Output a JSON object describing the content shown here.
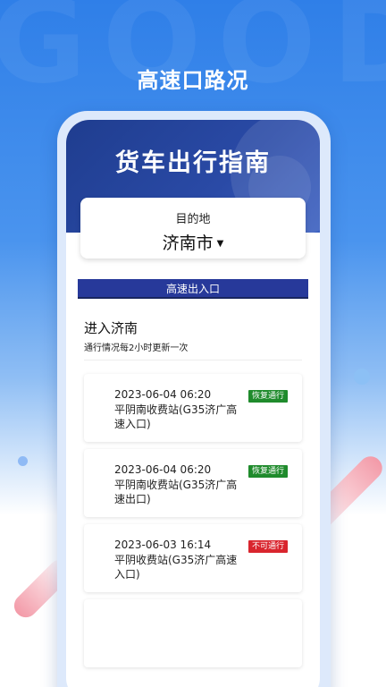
{
  "watermark": "GOOD",
  "header": {
    "title": "高速口路况"
  },
  "banner": {
    "title": "货车出行指南"
  },
  "city": {
    "label": "目的地",
    "value": "济南市",
    "caret": "▼"
  },
  "tab": {
    "label": "高速出入口"
  },
  "section": {
    "title": "进入济南",
    "subtitle": "通行情况每2小时更新一次"
  },
  "items": [
    {
      "time": "2023-06-04 06:20",
      "location": "平阴南收费站(G35济广高速入口)",
      "status": "恢复通行",
      "status_color": "#1f8b2c"
    },
    {
      "time": "2023-06-04 06:20",
      "location": "平阴南收费站(G35济广高速出口)",
      "status": "恢复通行",
      "status_color": "#1f8b2c"
    },
    {
      "time": "2023-06-03 16:14",
      "location": "平阴收费站(G35济广高速入口)",
      "status": "不可通行",
      "status_color": "#d9252e"
    }
  ],
  "colors": {
    "banner": "#1f3d8f",
    "tab": "#27399a",
    "ok": "#1f8b2c",
    "closed": "#d9252e"
  }
}
